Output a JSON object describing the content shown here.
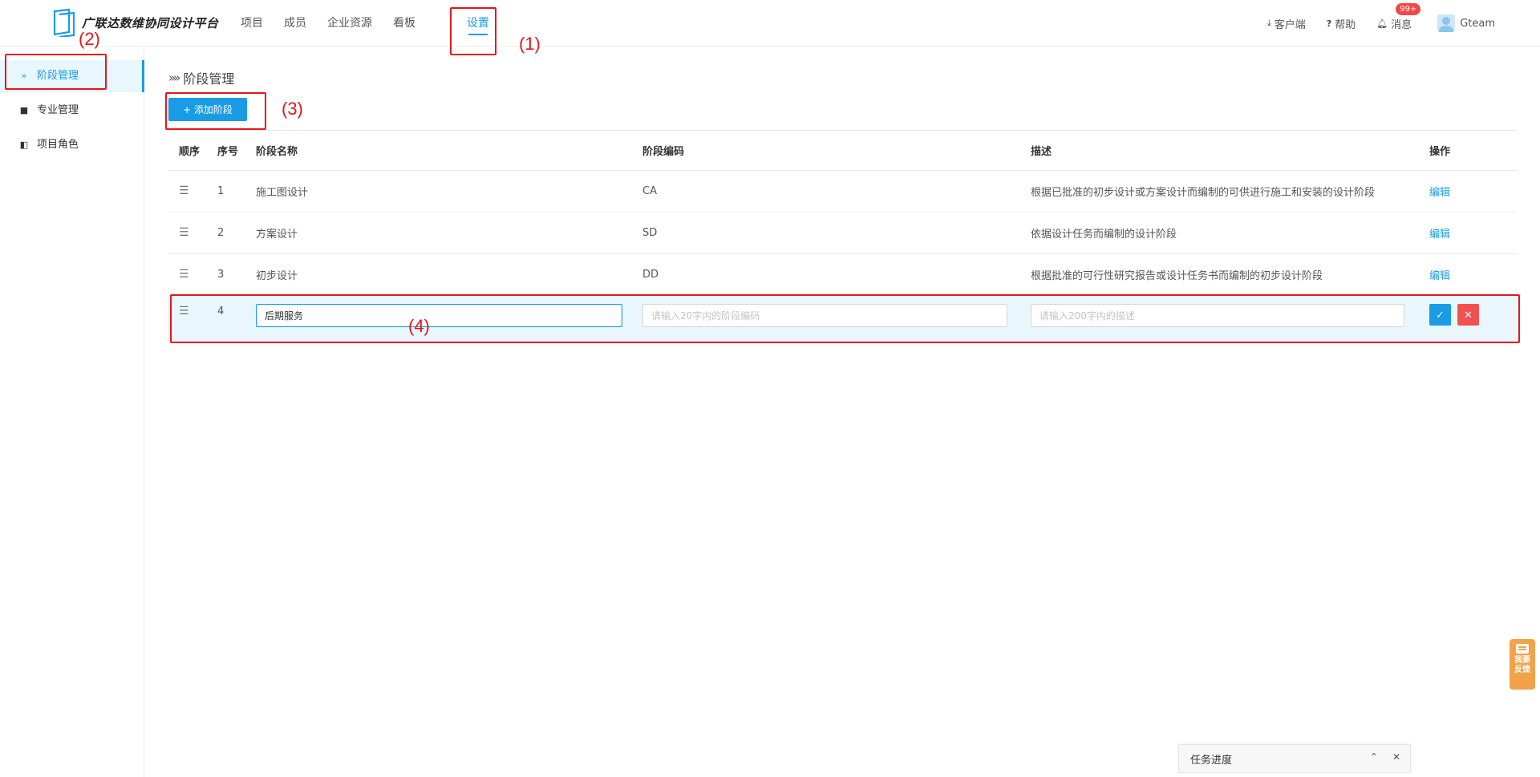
{
  "app": {
    "logo_text": "广联达数维协同设计平台"
  },
  "nav": {
    "items": [
      {
        "label": "项目"
      },
      {
        "label": "成员"
      },
      {
        "label": "企业资源"
      },
      {
        "label": "看板"
      },
      {
        "label": "设置",
        "active": true
      }
    ]
  },
  "top_right": {
    "client_label": "客户端",
    "help_label": "帮助",
    "message_label": "消息",
    "message_badge": "99+",
    "user_name": "Gteam"
  },
  "sidebar": {
    "items": [
      {
        "label": "阶段管理",
        "icon": "double-chevron-icon",
        "active": true
      },
      {
        "label": "专业管理",
        "icon": "book-icon"
      },
      {
        "label": "项目角色",
        "icon": "role-icon"
      }
    ]
  },
  "main": {
    "title": "阶段管理",
    "add_button": "+ 添加阶段",
    "table": {
      "headers": [
        "顺序",
        "序号",
        "阶段名称",
        "阶段编码",
        "描述",
        "操作"
      ],
      "rows": [
        {
          "index": "1",
          "name": "施工图设计",
          "code": "CA",
          "desc": "根据已批准的初步设计或方案设计而编制的可供进行施工和安装的设计阶段",
          "action": "编辑"
        },
        {
          "index": "2",
          "name": "方案设计",
          "code": "SD",
          "desc": "依据设计任务而编制的设计阶段",
          "action": "编辑"
        },
        {
          "index": "3",
          "name": "初步设计",
          "code": "DD",
          "desc": "根据批准的可行性研究报告或设计任务书而编制的初步设计阶段",
          "action": "编辑"
        }
      ],
      "edit_row": {
        "index": "4",
        "name_value": "后期服务",
        "code_placeholder": "请输入20字内的阶段编码",
        "desc_placeholder": "请输入200字内的描述"
      }
    }
  },
  "annotations": {
    "labels": [
      "(1)",
      "(2)",
      "(3)",
      "(4)"
    ]
  },
  "feedback": {
    "line1": "我要",
    "line2": "反馈"
  },
  "task_bar": {
    "title": "任务进度"
  },
  "colors": {
    "accent": "#1a9be6",
    "danger": "#f05252",
    "annotation": "#e8151b",
    "feedback": "#f3a24b"
  }
}
